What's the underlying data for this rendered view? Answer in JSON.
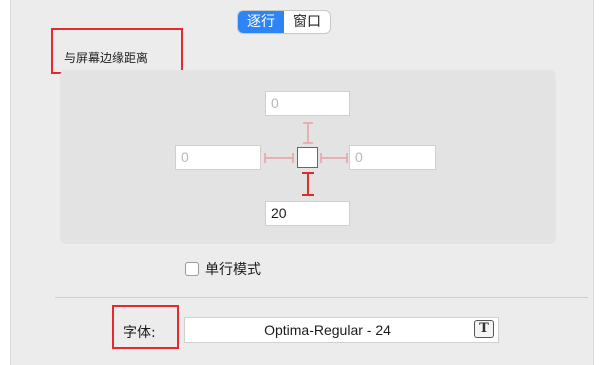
{
  "tabs": [
    {
      "label": "逐行",
      "active": true
    },
    {
      "label": "窗口",
      "active": false
    }
  ],
  "margins": {
    "label": "与屏幕边缘距离",
    "top_value": "0",
    "left_value": "0",
    "right_value": "0",
    "bottom_value": "20"
  },
  "single_line": {
    "label": "单行模式",
    "checked": false
  },
  "font": {
    "label": "字体:",
    "value": "Optima-Regular - 24",
    "picker_icon": "T"
  },
  "colors": {
    "accent": "#2d84f5",
    "highlight": "#e8282f",
    "strut_inactive": "#e8a0a4",
    "strut_active": "#d9302f"
  }
}
